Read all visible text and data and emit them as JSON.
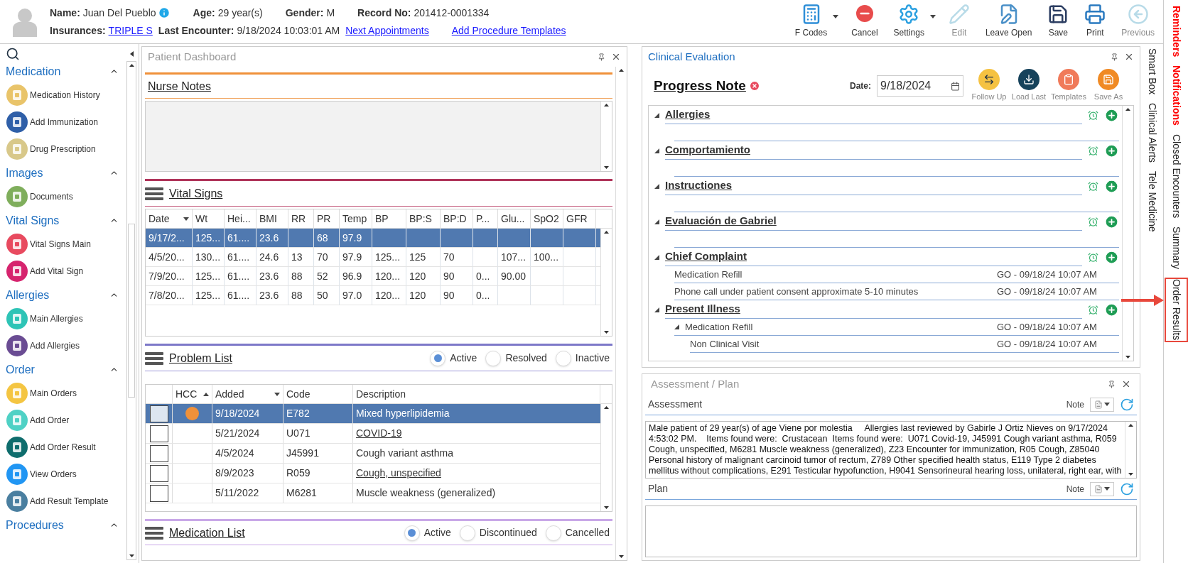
{
  "patient": {
    "rows": [
      [
        {
          "kind": "info",
          "label": "Name:",
          "value": "Juan Del Pueblo"
        },
        {
          "kind": "text",
          "label": "Age:",
          "value": "29 year(s)"
        },
        {
          "kind": "text",
          "label": "Gender:",
          "value": "M"
        },
        {
          "kind": "text",
          "label": "Record No:",
          "value": "201412-0001334"
        }
      ],
      [
        {
          "kind": "link",
          "label": "Insurances:",
          "value": "TRIPLE S"
        },
        {
          "kind": "text",
          "label": "Last Encounter:",
          "value": "9/18/2024 10:03:01 AM"
        }
      ]
    ],
    "links": [
      "Next Appointments",
      "Add Procedure Templates"
    ]
  },
  "toolbar": [
    {
      "label": "F Codes",
      "disabled": false,
      "dropdown": true
    },
    {
      "label": "Cancel",
      "disabled": false,
      "dropdown": false
    },
    {
      "label": "Settings",
      "disabled": false,
      "dropdown": true
    },
    {
      "label": "Edit",
      "disabled": true,
      "dropdown": false
    },
    {
      "label": "Leave Open",
      "disabled": false,
      "dropdown": false
    },
    {
      "label": "Save",
      "disabled": false,
      "dropdown": false
    },
    {
      "label": "Print",
      "disabled": false,
      "dropdown": false
    },
    {
      "label": "Previous",
      "disabled": true,
      "dropdown": false
    }
  ],
  "sidebar": {
    "sections": [
      {
        "title": "Medication",
        "expanded": true,
        "items": [
          "Medication History",
          "Add Immunization",
          "Drug Prescription"
        ]
      },
      {
        "title": "Images",
        "expanded": true,
        "items": [
          "Documents"
        ]
      },
      {
        "title": "Vital Signs",
        "expanded": true,
        "items": [
          "Vital Signs Main",
          "Add Vital Sign"
        ]
      },
      {
        "title": "Allergies",
        "expanded": true,
        "items": [
          "Main Allergies",
          "Add Allergies"
        ]
      },
      {
        "title": "Order",
        "expanded": true,
        "items": [
          "Main Orders",
          "Add Order",
          "Add Order Result",
          "View Orders",
          "Add Result Template"
        ]
      },
      {
        "title": "Procedures",
        "expanded": true
      }
    ]
  },
  "dashboard": {
    "title": "Patient Dashboard",
    "nurse_notes": {
      "title": "Nurse Notes"
    },
    "vital_signs": {
      "title": "Vital Signs",
      "columns": [
        "Date",
        "Wt",
        "Hei...",
        "BMI",
        "RR",
        "PR",
        "Temp",
        "BP",
        "BP:S",
        "BP:D",
        "P...",
        "Glu...",
        "SpO2",
        "GFR"
      ],
      "rows": [
        {
          "selected": true,
          "cells": [
            "9/17/2...",
            "125...",
            "61....",
            "23.6",
            "",
            "68",
            "97.9",
            "",
            "",
            "",
            "",
            "",
            "",
            ""
          ]
        },
        {
          "selected": false,
          "cells": [
            "4/5/20...",
            "130...",
            "61....",
            "24.6",
            "13",
            "70",
            "97.9",
            "125...",
            "125",
            "70",
            "",
            "107...",
            "100...",
            ""
          ]
        },
        {
          "selected": false,
          "cells": [
            "7/9/20...",
            "125...",
            "61....",
            "23.6",
            "88",
            "52",
            "96.9",
            "120...",
            "120",
            "90",
            "0...",
            "90.00",
            "",
            ""
          ]
        },
        {
          "selected": false,
          "cells": [
            "7/8/20...",
            "125...",
            "61....",
            "23.6",
            "88",
            "50",
            "97.0",
            "120...",
            "120",
            "90",
            "0...",
            "",
            "",
            " "
          ]
        }
      ]
    },
    "problem_list": {
      "title": "Problem List",
      "filters": [
        {
          "label": "Active",
          "selected": true
        },
        {
          "label": "Resolved",
          "selected": false
        },
        {
          "label": "Inactive",
          "selected": false
        }
      ],
      "columns": [
        "HCC",
        "Added",
        "Code",
        "Description"
      ],
      "rows": [
        {
          "selected": true,
          "checked": false,
          "color": "#f0913a",
          "added": "9/18/2024",
          "code": "E782",
          "description": "Mixed hyperlipidemia",
          "link": false
        },
        {
          "selected": false,
          "checked": false,
          "added": "5/21/2024",
          "code": "U071",
          "description": "COVID-19",
          "link": true
        },
        {
          "selected": false,
          "checked": false,
          "added": "4/5/2024",
          "code": "J45991",
          "description": "Cough variant asthma",
          "link": false
        },
        {
          "selected": false,
          "checked": false,
          "added": "8/9/2023",
          "code": "R059",
          "description": "Cough, unspecified",
          "link": true
        },
        {
          "selected": false,
          "checked": false,
          "added": "5/11/2022",
          "code": "M6281",
          "description": "Muscle weakness (generalized)",
          "link": false
        }
      ]
    },
    "medication_list": {
      "title": "Medication List",
      "filters": [
        {
          "label": "Active",
          "selected": true
        },
        {
          "label": "Discontinued",
          "selected": false
        },
        {
          "label": "Cancelled",
          "selected": false
        }
      ]
    }
  },
  "clinical": {
    "title": "Clinical Evaluation",
    "note_title": "Progress Note",
    "date_label": "Date:",
    "date": "9/18/2024",
    "actions": [
      "Follow Up",
      "Load Last",
      "Templates",
      "Save As"
    ],
    "sections": [
      {
        "title": "Allergies",
        "expanded": true
      },
      {
        "title": "Comportamiento",
        "expanded": true
      },
      {
        "title": "Instructiones",
        "expanded": true
      },
      {
        "title": "Evaluación de Gabriel",
        "expanded": true
      },
      {
        "title": "Chief Complaint",
        "expanded": true,
        "entries": [
          {
            "text": "Medication Refill",
            "stamp": "GO - 09/18/24 10:07 AM"
          },
          {
            "text": "Phone call under patient consent approximate 5-10 minutes",
            "stamp": "GO - 09/18/24 10:07 AM"
          }
        ]
      },
      {
        "title": "Present Illness",
        "expanded": true,
        "entries": [
          {
            "text": "Medication Refill",
            "stamp": "GO - 09/18/24 10:07 AM",
            "expanded": true,
            "children": [
              {
                "text": "Non Clinical Visit",
                "stamp": "GO - 09/18/24 10:07 AM"
              }
            ]
          }
        ]
      }
    ]
  },
  "assessment_plan": {
    "title": "Assessment / Plan",
    "parts": [
      {
        "label": "Assessment",
        "note_label": "Note",
        "value": "Male patient of 29 year(s) of age Viene por molestia     Allergies last reviewed by Gabirle J Ortiz Nieves on 9/17/2024 4:53:02 PM.    Items found were:  Crustacean  Items found were:  U071 Covid-19, J45991 Cough variant asthma, R059 Cough, unspecified, M6281 Muscle weakness (generalized), Z23 Encounter for immunization, R05 Cough, Z85040 Personal history of malignant carcinoid tumor of rectum, Z789 Other specified health status, E119 Type 2 diabetes mellitus without complications, E291 Testicular hypofunction, H9041 Sensorineural hearing loss, unilateral, right ear, with"
      },
      {
        "label": "Plan",
        "note_label": "Note"
      }
    ]
  },
  "side_tabs": [
    "Smart Box",
    "Clinical Alerts",
    "Tele Medicine"
  ],
  "right_tabs": [
    {
      "label": "Reminders",
      "alert": true,
      "highlighted": false
    },
    {
      "label": "Notifications",
      "alert": true,
      "highlighted": false
    },
    {
      "label": "Closed Encounters",
      "alert": false,
      "highlighted": false
    },
    {
      "label": "Summary",
      "alert": false,
      "highlighted": false
    },
    {
      "label": "Order Results",
      "alert": false,
      "highlighted": true
    }
  ]
}
